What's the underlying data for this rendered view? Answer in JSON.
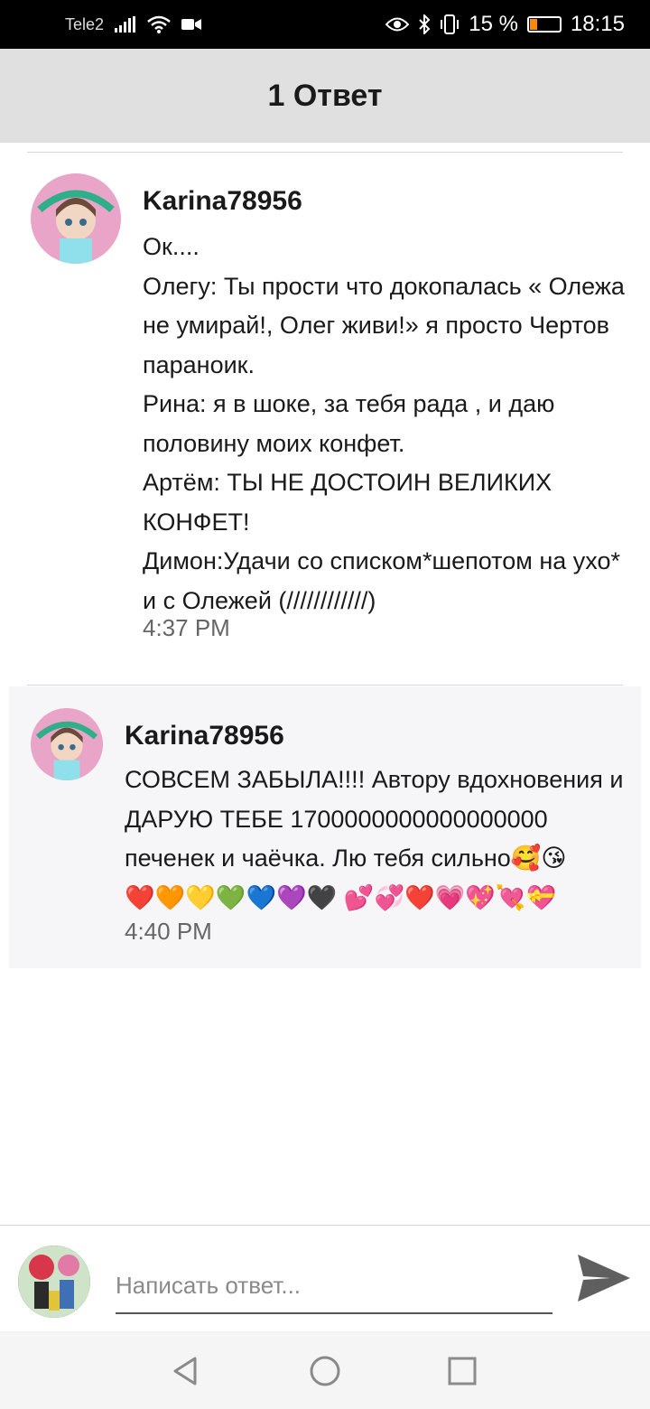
{
  "status_bar": {
    "carrier": "Tele2",
    "battery_percent": "15 %",
    "time": "18:15",
    "icons": [
      "signal-icon",
      "wifi-icon",
      "video-icon",
      "eye-icon",
      "bluetooth-icon",
      "vibrate-icon",
      "battery-icon"
    ]
  },
  "header": {
    "title": "1 Ответ"
  },
  "comments": [
    {
      "username": "Karina78956",
      "text": "Ок....\nОлегу: Ты прости что докопалась « Олежа не умирай!, Олег живи!» я просто Чертов параноик.\nРина: я в шоке, за тебя рада , и даю половину моих конфет.\nАртём: ТЫ НЕ ДОСТОИН ВЕЛИКИХ КОНФЕТ!\nДимон:Удачи со списком*шепотом на ухо* и с Олежей (////////////)",
      "time": "4:37 PM"
    },
    {
      "username": "Karina78956",
      "text": "СОВСЕМ ЗАБЫЛА!!!! Автору вдохновения и ДАРУЮ ТЕБЕ 1700000000000000000 печенек и чаёчка. Лю тебя сильно🥰😘\n❤️🧡💛💚💙💜🖤 💕💞❤️💗💖💘💝",
      "time": "4:40 PM"
    }
  ],
  "reply": {
    "placeholder": "Написать ответ..."
  },
  "colors": {
    "header_bg": "#e0e0e0",
    "highlight_bg": "#f6f5f8",
    "time_text": "#666666"
  }
}
